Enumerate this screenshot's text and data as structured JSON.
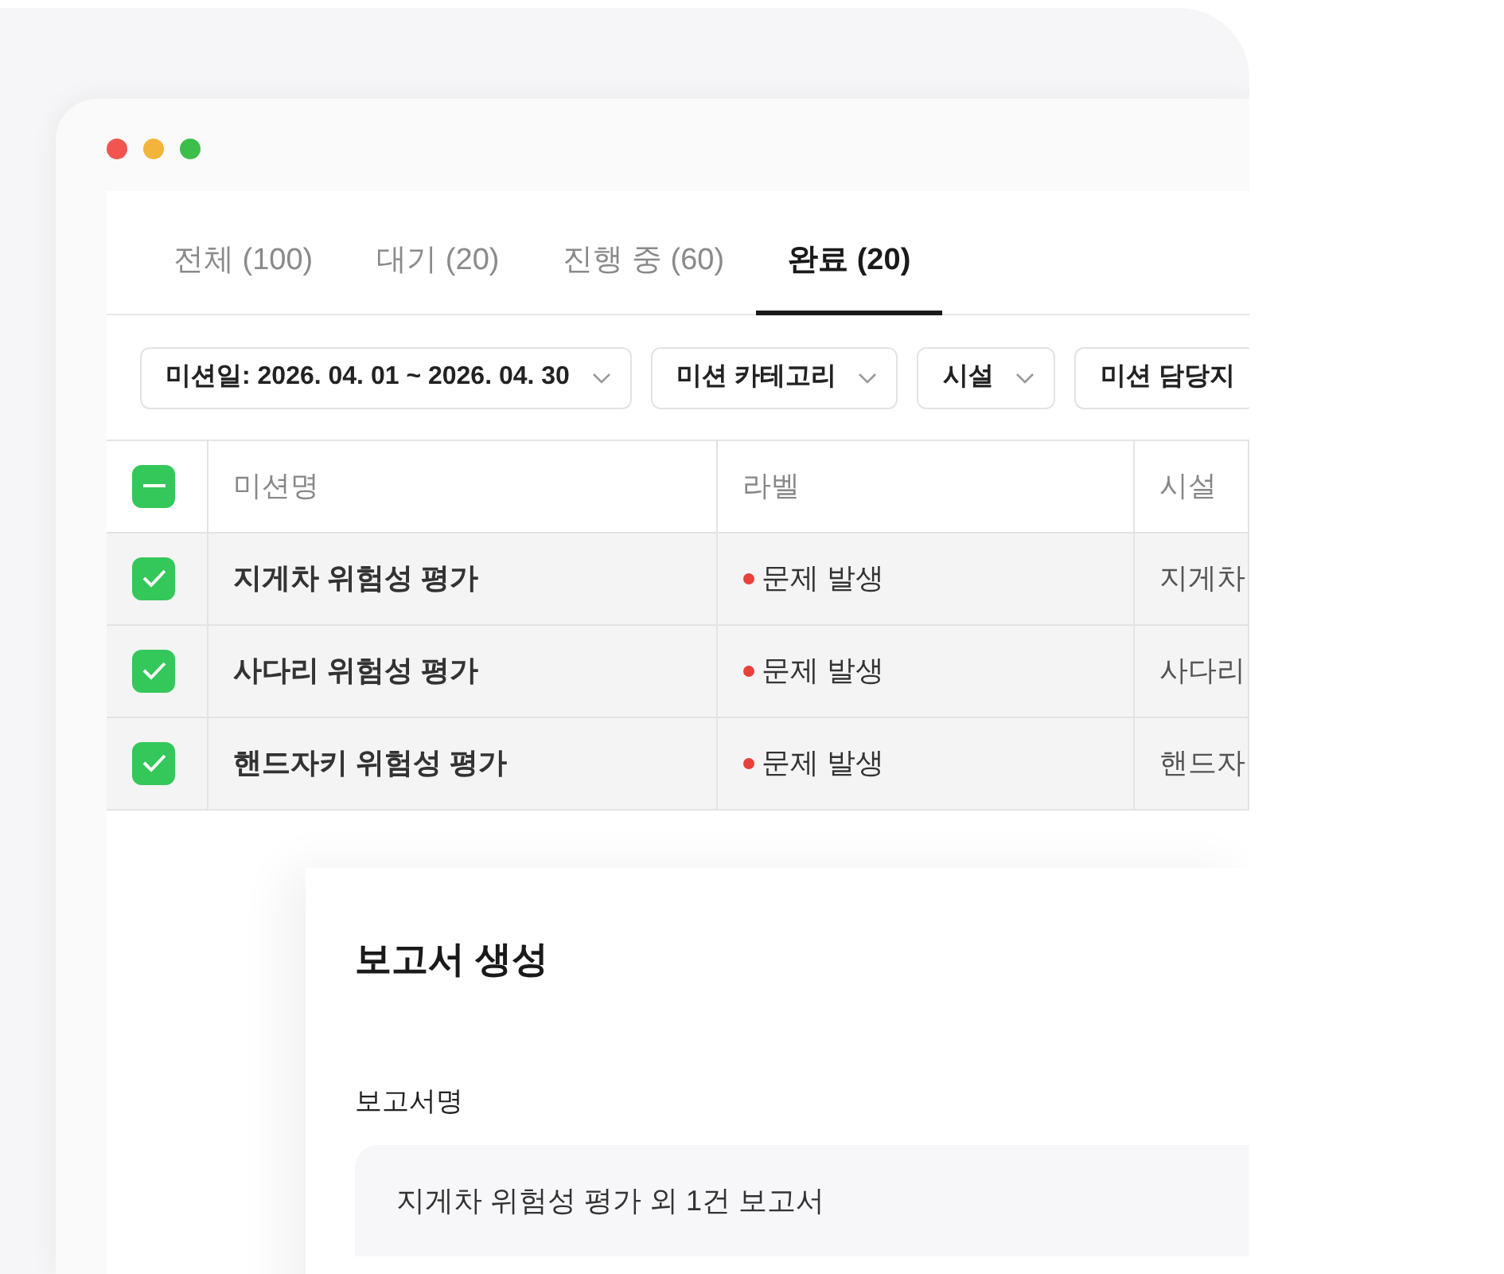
{
  "tabs": [
    {
      "label": "전체 (100)",
      "selected": false
    },
    {
      "label": "대기 (20)",
      "selected": false
    },
    {
      "label": "진행 중 (60)",
      "selected": false
    },
    {
      "label": "완료 (20)",
      "selected": true
    }
  ],
  "filters": [
    {
      "label": "미션일: 2026. 04. 01 ~ 2026. 04. 30"
    },
    {
      "label": "미션 카테고리"
    },
    {
      "label": "시설"
    },
    {
      "label": "미션 담당지"
    }
  ],
  "table": {
    "select_all": {
      "checked": true,
      "partial": true
    },
    "columns": [
      "미션명",
      "라벨",
      "시설"
    ],
    "rows": [
      {
        "selected": true,
        "name": "지게차 위험성 평가",
        "label": "문제 발생",
        "color": "#e8403a",
        "facility": "지게차"
      },
      {
        "selected": true,
        "name": "사다리 위험성 평가",
        "label": "문제 발생",
        "color": "#e8403a",
        "facility": "사다리"
      },
      {
        "selected": true,
        "name": "핸드자키 위험성 평가",
        "label": "문제 발생",
        "color": "#e8403a",
        "facility": "핸드자"
      }
    ]
  },
  "report": {
    "title": "보고서 생성",
    "field_label": "보고서명",
    "value": "지게차 위험성 평가 외 1건 보고서"
  }
}
